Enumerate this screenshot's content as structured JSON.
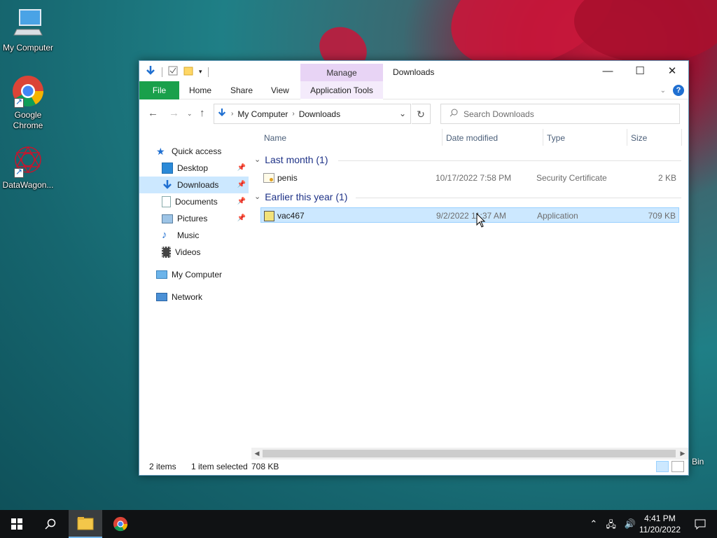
{
  "desktop": {
    "icons": [
      {
        "label": "My Computer"
      },
      {
        "label": "Google Chrome"
      },
      {
        "label": "DataWagon..."
      }
    ],
    "recycle_bin_partial": "Bin"
  },
  "window": {
    "title": "Downloads",
    "manage_tab": "Manage",
    "ribbon": {
      "file": "File",
      "home": "Home",
      "share": "Share",
      "view": "View",
      "app_tools": "Application Tools"
    },
    "address": {
      "crumbs": [
        "My Computer",
        "Downloads"
      ]
    },
    "search_placeholder": "Search Downloads",
    "nav": [
      {
        "label": "Quick access"
      },
      {
        "label": "Desktop"
      },
      {
        "label": "Downloads"
      },
      {
        "label": "Documents"
      },
      {
        "label": "Pictures"
      },
      {
        "label": "Music"
      },
      {
        "label": "Videos"
      },
      {
        "label": "My Computer"
      },
      {
        "label": "Network"
      }
    ],
    "columns": {
      "name": "Name",
      "date": "Date modified",
      "type": "Type",
      "size": "Size"
    },
    "groups": [
      {
        "label": "Last month (1)",
        "files": [
          {
            "name": "penis",
            "date": "10/17/2022 7:58 PM",
            "type": "Security Certificate",
            "size": "2 KB"
          }
        ]
      },
      {
        "label": "Earlier this year (1)",
        "files": [
          {
            "name": "vac467",
            "date": "9/2/2022 11:37 AM",
            "type": "Application",
            "size": "709 KB"
          }
        ]
      }
    ],
    "status": {
      "items": "2 items",
      "selected": "1 item selected",
      "size": "708 KB"
    }
  },
  "taskbar": {
    "time": "4:41 PM",
    "date": "11/20/2022"
  }
}
